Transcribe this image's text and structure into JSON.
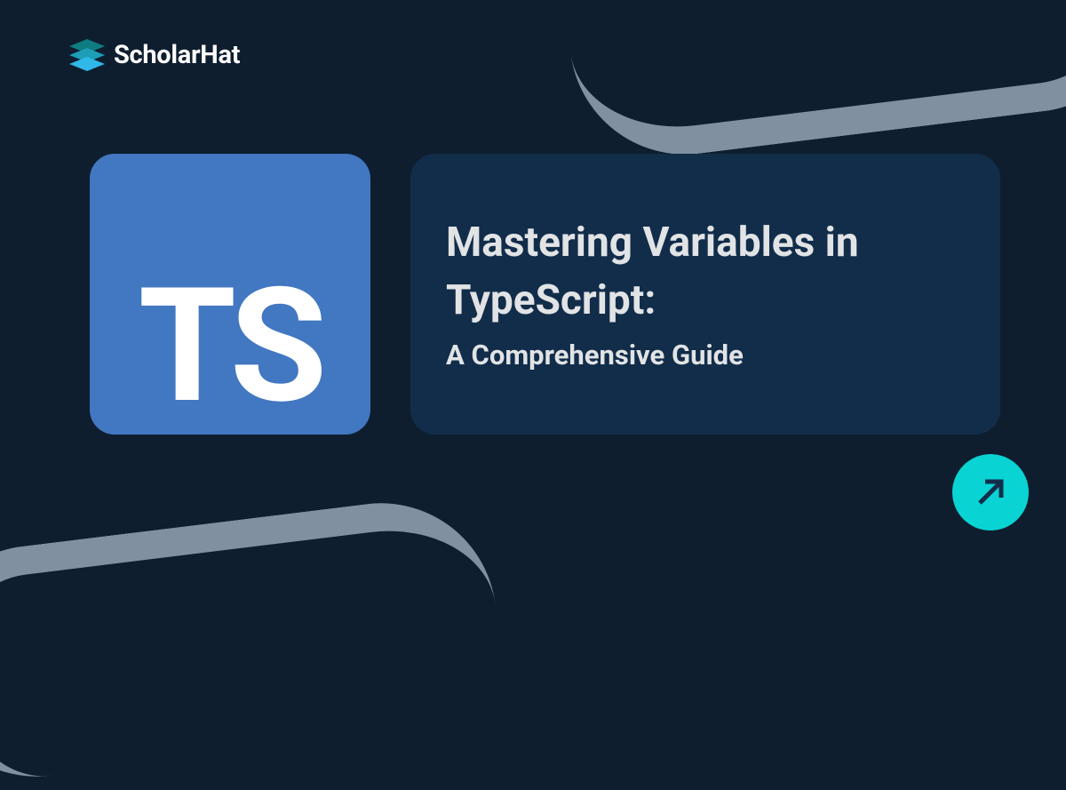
{
  "brand": {
    "name": "ScholarHat"
  },
  "badge": {
    "text": "TS"
  },
  "content": {
    "title_main": "Mastering Variables in TypeScript:",
    "title_sub": "A Comprehensive Guide"
  }
}
